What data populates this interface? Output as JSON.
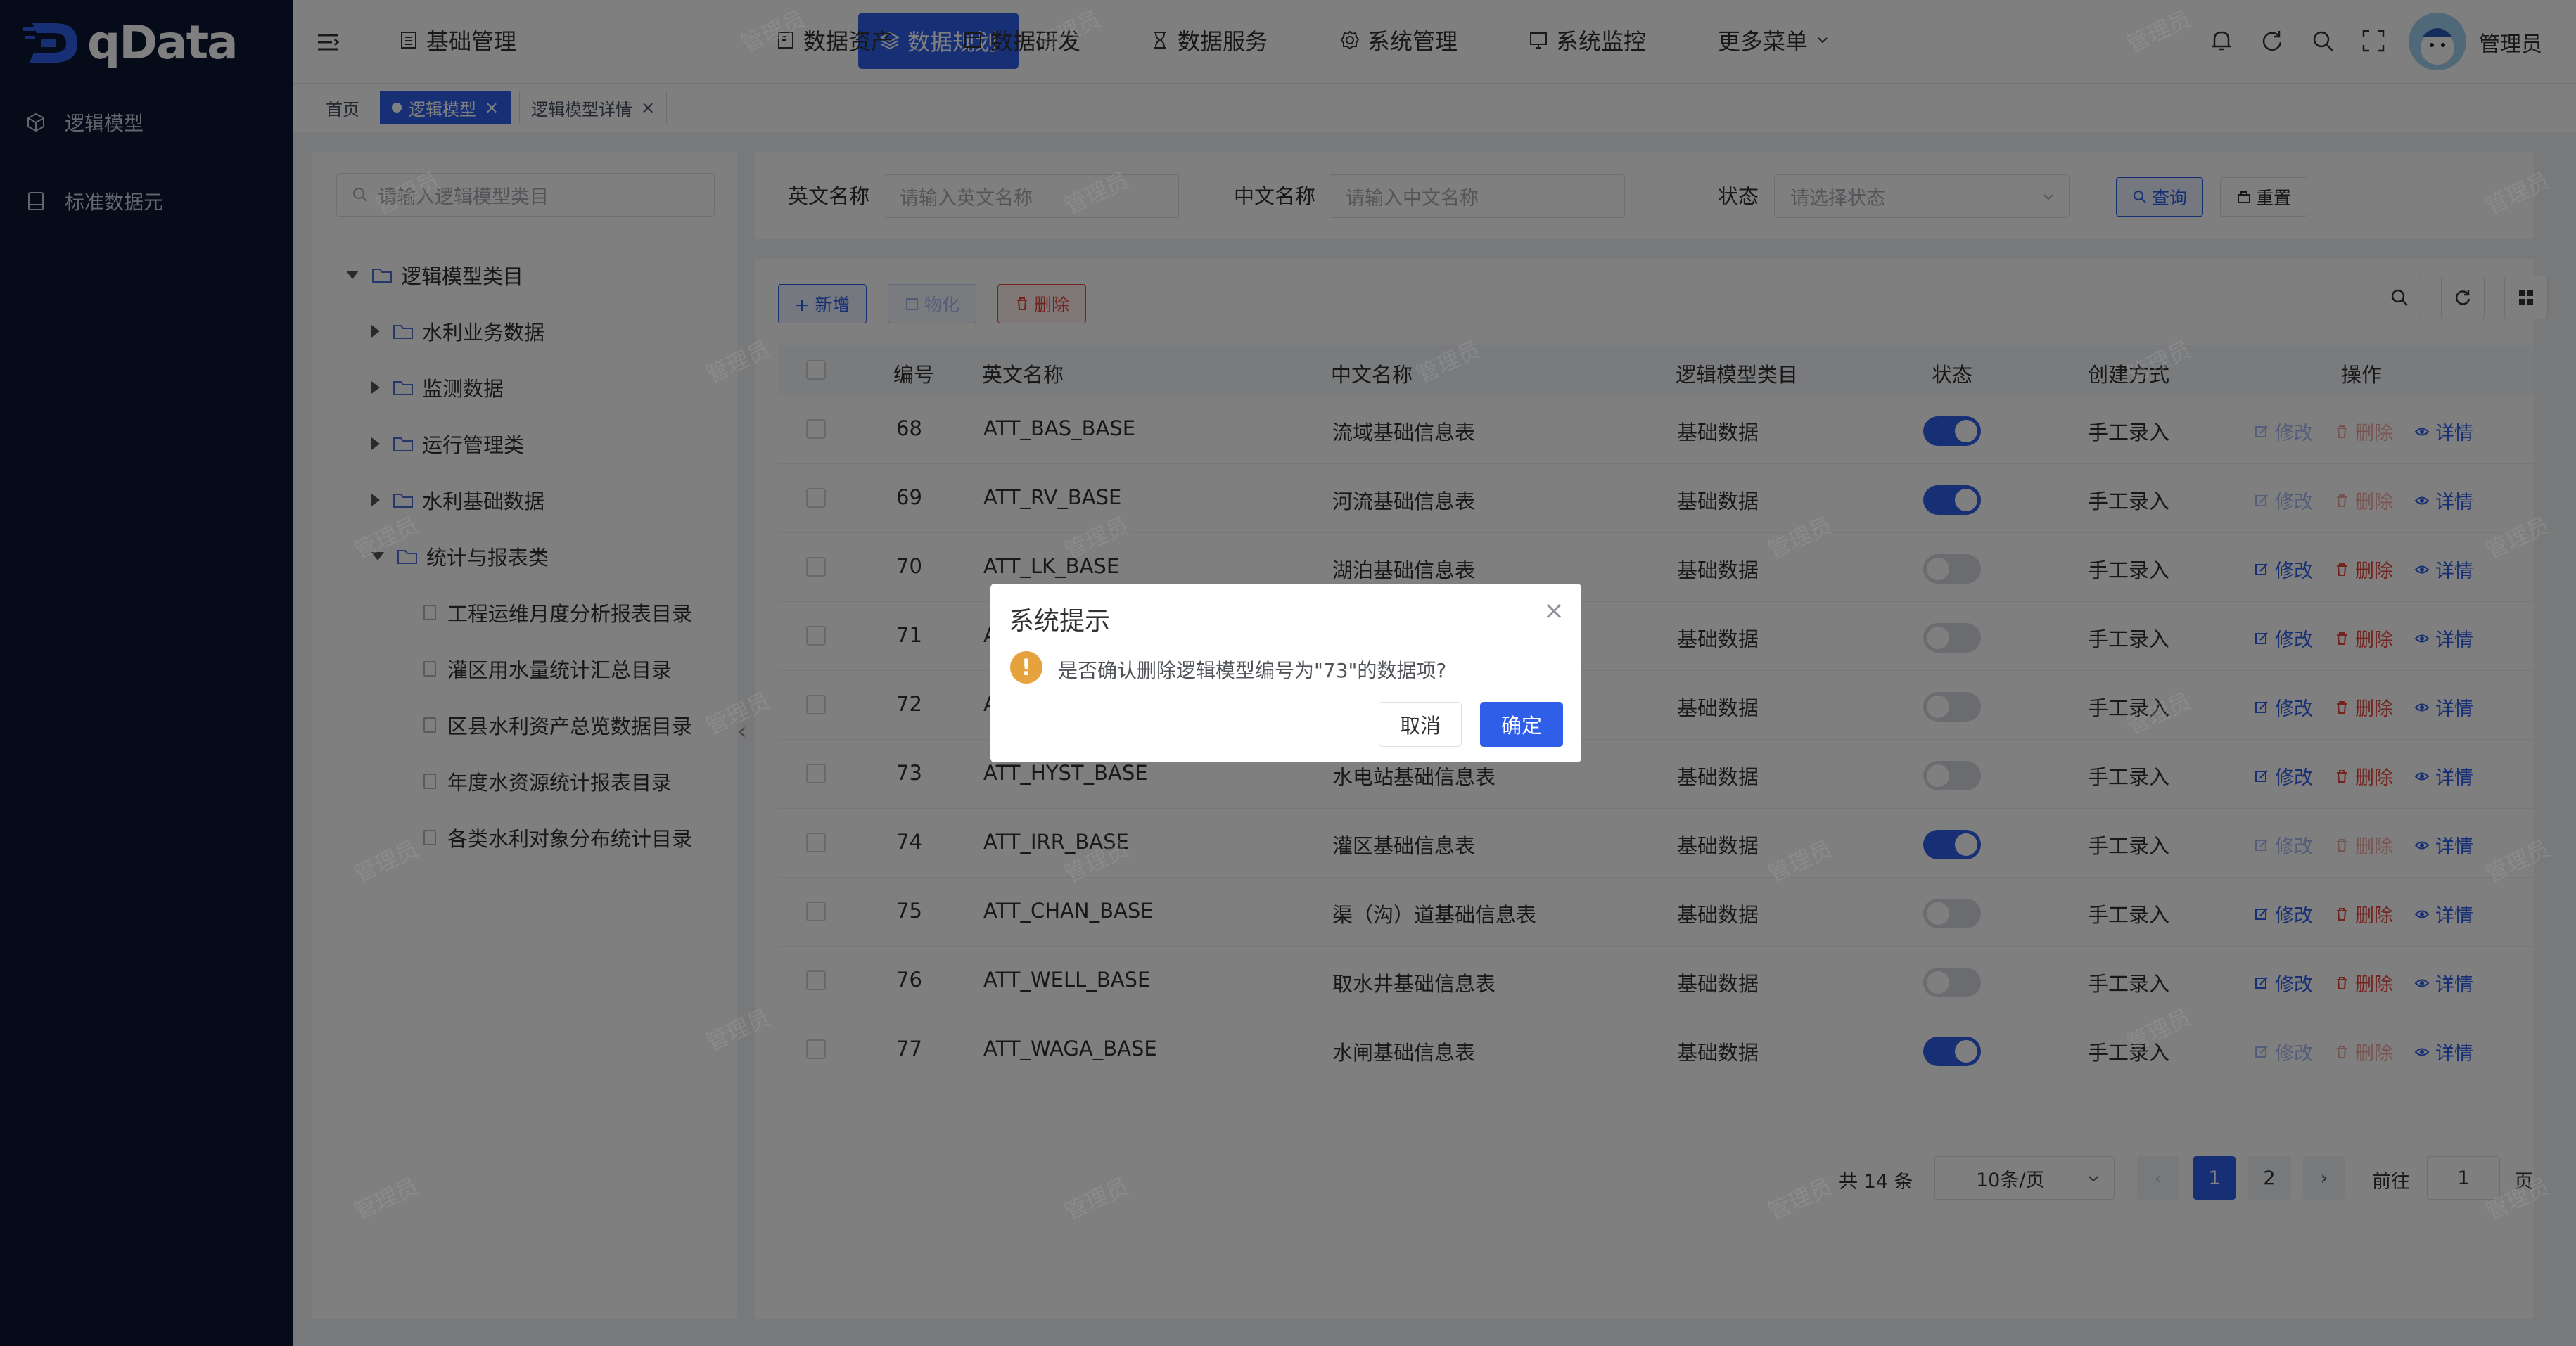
{
  "app": {
    "logo_text": "qData"
  },
  "sidebar": {
    "items": [
      {
        "label": "逻辑模型",
        "icon": "cube-icon"
      },
      {
        "label": "标准数据元",
        "icon": "database-icon"
      }
    ]
  },
  "topnav": {
    "items": [
      {
        "label": "基础管理",
        "icon": "list-icon"
      },
      {
        "label": "数据规划",
        "icon": "layers-icon",
        "active": true
      },
      {
        "label": "数据资产",
        "icon": "asset-icon"
      },
      {
        "label": "数据研发",
        "icon": "window-icon"
      },
      {
        "label": "数据服务",
        "icon": "hourglass-icon"
      },
      {
        "label": "系统管理",
        "icon": "gear-icon"
      },
      {
        "label": "系统监控",
        "icon": "monitor-icon"
      },
      {
        "label": "更多菜单",
        "icon": "chevron-down-icon"
      }
    ],
    "user_name": "管理员"
  },
  "tabs": [
    {
      "label": "首页"
    },
    {
      "label": "逻辑模型",
      "active": true
    },
    {
      "label": "逻辑模型详情"
    }
  ],
  "tree": {
    "search_placeholder": "请输入逻辑模型类目",
    "root": "逻辑模型类目",
    "nodes": [
      {
        "label": "水利业务数据"
      },
      {
        "label": "监测数据"
      },
      {
        "label": "运行管理类"
      },
      {
        "label": "水利基础数据"
      },
      {
        "label": "统计与报表类"
      }
    ],
    "leaves": [
      {
        "label": "工程运维月度分析报表目录"
      },
      {
        "label": "灌区用水量统计汇总目录"
      },
      {
        "label": "区县水利资产总览数据目录"
      },
      {
        "label": "年度水资源统计报表目录"
      },
      {
        "label": "各类水利对象分布统计目录"
      }
    ]
  },
  "filters": {
    "en_name_label": "英文名称",
    "en_name_placeholder": "请输入英文名称",
    "cn_name_label": "中文名称",
    "cn_name_placeholder": "请输入中文名称",
    "status_label": "状态",
    "status_placeholder": "请选择状态",
    "query_button": "查询",
    "reset_button": "重置"
  },
  "toolbar": {
    "add": "+ 新增",
    "materialize": "物化",
    "delete": "删除"
  },
  "table": {
    "columns": [
      "编号",
      "英文名称",
      "中文名称",
      "逻辑模型类目",
      "状态",
      "创建方式",
      "操作"
    ],
    "rows": [
      {
        "id": "68",
        "en": "ATT_BAS_BASE",
        "cn": "流域基础信息表",
        "cat": "基础数据",
        "on": true,
        "method": "手工录入"
      },
      {
        "id": "69",
        "en": "ATT_RV_BASE",
        "cn": "河流基础信息表",
        "cat": "基础数据",
        "on": true,
        "method": "手工录入"
      },
      {
        "id": "70",
        "en": "ATT_LK_BASE",
        "cn": "湖泊基础信息表",
        "cat": "基础数据",
        "on": false,
        "method": "手工录入"
      },
      {
        "id": "71",
        "en": "A",
        "cn": "",
        "cat": "基础数据",
        "on": false,
        "method": "手工录入"
      },
      {
        "id": "72",
        "en": "A",
        "cn": "",
        "cat": "基础数据",
        "on": false,
        "method": "手工录入"
      },
      {
        "id": "73",
        "en": "ATT_HYST_BASE",
        "cn": "水电站基础信息表",
        "cat": "基础数据",
        "on": false,
        "method": "手工录入"
      },
      {
        "id": "74",
        "en": "ATT_IRR_BASE",
        "cn": "灌区基础信息表",
        "cat": "基础数据",
        "on": true,
        "method": "手工录入"
      },
      {
        "id": "75",
        "en": "ATT_CHAN_BASE",
        "cn": "渠（沟）道基础信息表",
        "cat": "基础数据",
        "on": false,
        "method": "手工录入"
      },
      {
        "id": "76",
        "en": "ATT_WELL_BASE",
        "cn": "取水井基础信息表",
        "cat": "基础数据",
        "on": false,
        "method": "手工录入"
      },
      {
        "id": "77",
        "en": "ATT_WAGA_BASE",
        "cn": "水闸基础信息表",
        "cat": "基础数据",
        "on": true,
        "method": "手工录入"
      }
    ],
    "ops": {
      "edit": "修改",
      "delete": "删除",
      "detail": "详情"
    }
  },
  "pagination": {
    "total": "共 14 条",
    "page_size": "10条/页",
    "pages": [
      "1",
      "2"
    ],
    "goto_label": "前往",
    "goto_value": "1",
    "page_suffix": "页"
  },
  "watermark": "管理员",
  "dialog": {
    "title": "系统提示",
    "message": "是否确认删除逻辑模型编号为\"73\"的数据项?",
    "cancel": "取消",
    "confirm": "确定"
  },
  "colors": {
    "primary": "#2f5ee8",
    "danger": "#e8463a",
    "sidebar": "#0b1733",
    "warning": "#e6a23c"
  }
}
